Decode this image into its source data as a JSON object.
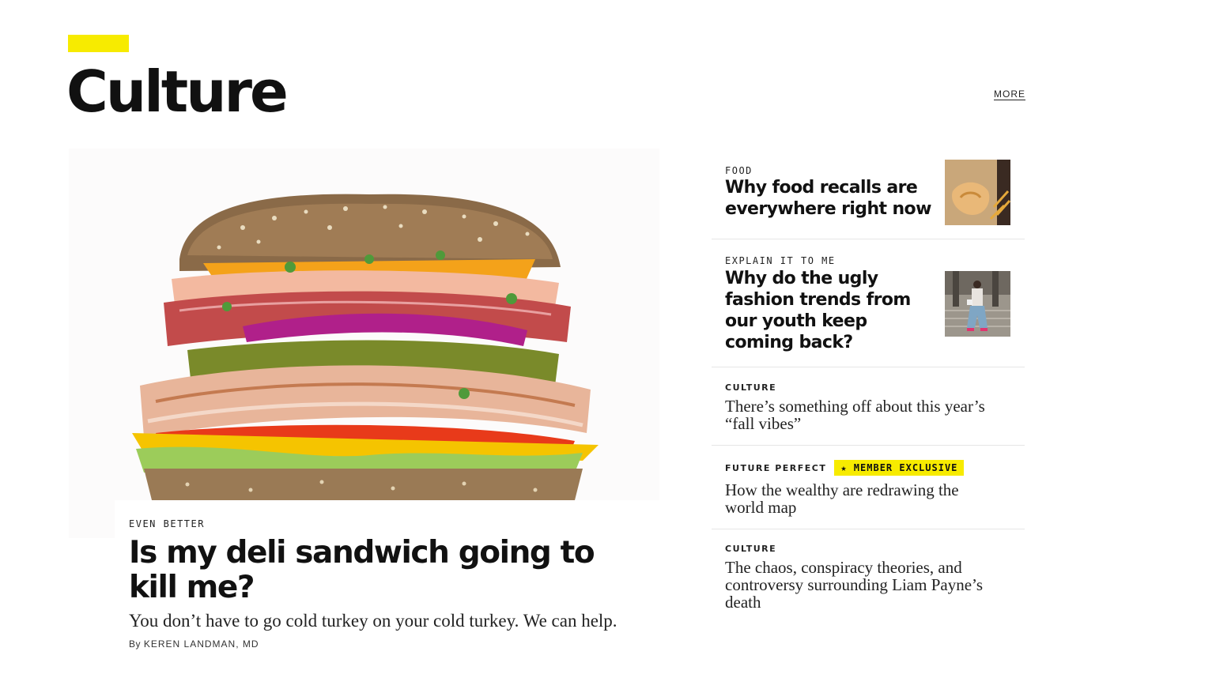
{
  "section": {
    "title": "Culture",
    "more_label": "MORE",
    "accent_color": "#f7eb00"
  },
  "feature": {
    "image_alt": "sandwich-photo",
    "kicker": "EVEN BETTER",
    "headline": "Is my deli sandwich going to kill me?",
    "dek": "You don’t have to go cold turkey on your cold turkey. We can help.",
    "byline_prefix": "By",
    "author": "KEREN LANDMAN, MD"
  },
  "sidebar": {
    "stories": [
      {
        "category": "FOOD",
        "headline": "Why food recalls are everywhere right now",
        "thumbnail": "fast-food-bag-photo"
      },
      {
        "category": "EXPLAIN IT TO ME",
        "headline": "Why do the ugly fashion trends from our youth keep coming back?",
        "thumbnail": "fashion-street-photo"
      },
      {
        "category": "CULTURE",
        "headline": "There’s something off about this year’s “fall vibes”"
      },
      {
        "category": "FUTURE PERFECT",
        "badge": "★ MEMBER EXCLUSIVE",
        "headline": "How the wealthy are redrawing the world map"
      },
      {
        "category": "CULTURE",
        "headline": "The chaos, conspiracy theories, and controversy surrounding Liam Payne’s death"
      }
    ]
  }
}
